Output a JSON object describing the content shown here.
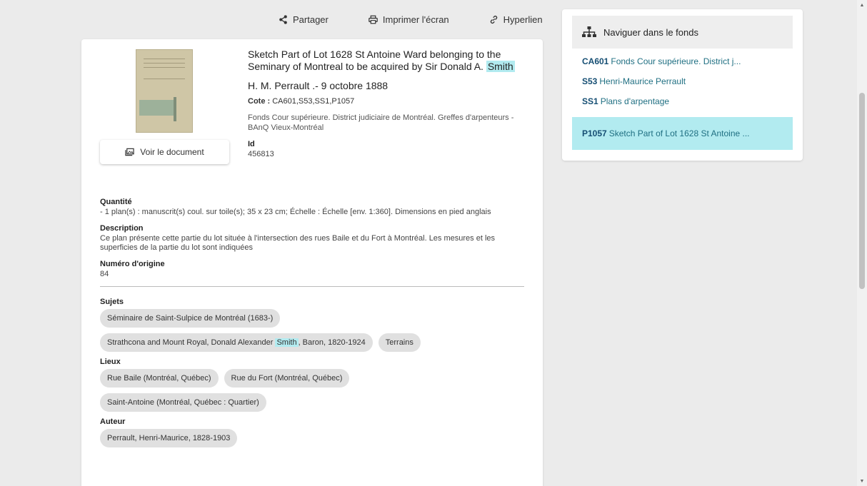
{
  "toolbar": {
    "share": "Partager",
    "print": "Imprimer l'écran",
    "link": "Hyperlien"
  },
  "record": {
    "title_pre": "Sketch Part of Lot 1628 St Antoine Ward belonging to the Seminary of Montreal to be acquired by Sir Donald A.",
    "title_hl": "Smith",
    "date": "H. M. Perrault .- 9 octobre 1888",
    "cote_label": "Cote :",
    "cote_value": "CA601,S53,SS1,P1057",
    "fonds": "Fonds Cour supérieure. District judiciaire de Montréal. Greffes d'arpenteurs - BAnQ Vieux-Montréal",
    "id_label": "Id",
    "id_value": "456813",
    "view_button": "Voir le document"
  },
  "meta": {
    "quantite_label": "Quantité",
    "quantite_value": "- 1 plan(s) : manuscrit(s) coul. sur toile(s); 35 x 23 cm; Échelle : Échelle [env. 1:360]. Dimensions en pied anglais",
    "description_label": "Description",
    "description_value": "Ce plan présente cette partie du lot située à l'intersection des rues Baile et du Fort à Montréal. Les mesures et les superficies de la partie du lot sont indiquées",
    "numero_label": "Numéro d'origine",
    "numero_value": "84",
    "sujets_label": "Sujets",
    "sujets": {
      "s1": "Séminaire de Saint-Sulpice de Montréal (1683-)",
      "s2_pre": "Strathcona and Mount Royal, Donald Alexander",
      "s2_hl": "Smith",
      "s2_post": ", Baron, 1820-1924",
      "s3": "Terrains"
    },
    "lieux_label": "Lieux",
    "lieux": [
      "Rue Baile (Montréal, Québec)",
      "Rue du Fort (Montréal, Québec)",
      "Saint-Antoine (Montréal, Québec : Quartier)"
    ],
    "auteur_label": "Auteur",
    "auteurs": [
      "Perrault, Henri-Maurice, 1828-1903"
    ]
  },
  "nav": {
    "title": "Naviguer dans le fonds",
    "items": [
      {
        "code": "CA601",
        "label": "Fonds Cour supérieure. District j..."
      },
      {
        "code": "S53",
        "label": "Henri-Maurice Perrault"
      },
      {
        "code": "SS1",
        "label": "Plans d'arpentage"
      },
      {
        "code": "P1057",
        "label": "Sketch Part of Lot 1628 St Antoine ..."
      }
    ]
  },
  "colors": {
    "highlight": "#b2ebf0",
    "link": "#1f6f82",
    "background": "#ebebeb"
  }
}
